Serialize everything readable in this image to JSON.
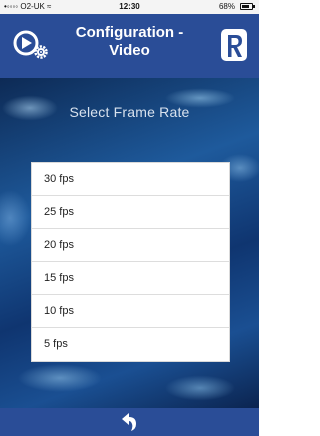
{
  "status_bar": {
    "carrier": "•◦◦◦◦ O2-UK ≈",
    "time": "12:30",
    "battery": "68%"
  },
  "header": {
    "title": "Configuration - Video",
    "background_color": "#2a4d97"
  },
  "section": {
    "title": "Select Frame Rate"
  },
  "frame_rates": [
    {
      "label": "30 fps"
    },
    {
      "label": "25 fps"
    },
    {
      "label": "20 fps"
    },
    {
      "label": "15 fps"
    },
    {
      "label": "10 fps"
    },
    {
      "label": "5 fps"
    }
  ],
  "icons": {
    "left": "video-settings-icon",
    "right": "remote-icon",
    "bottom": "back-arrow-icon"
  }
}
